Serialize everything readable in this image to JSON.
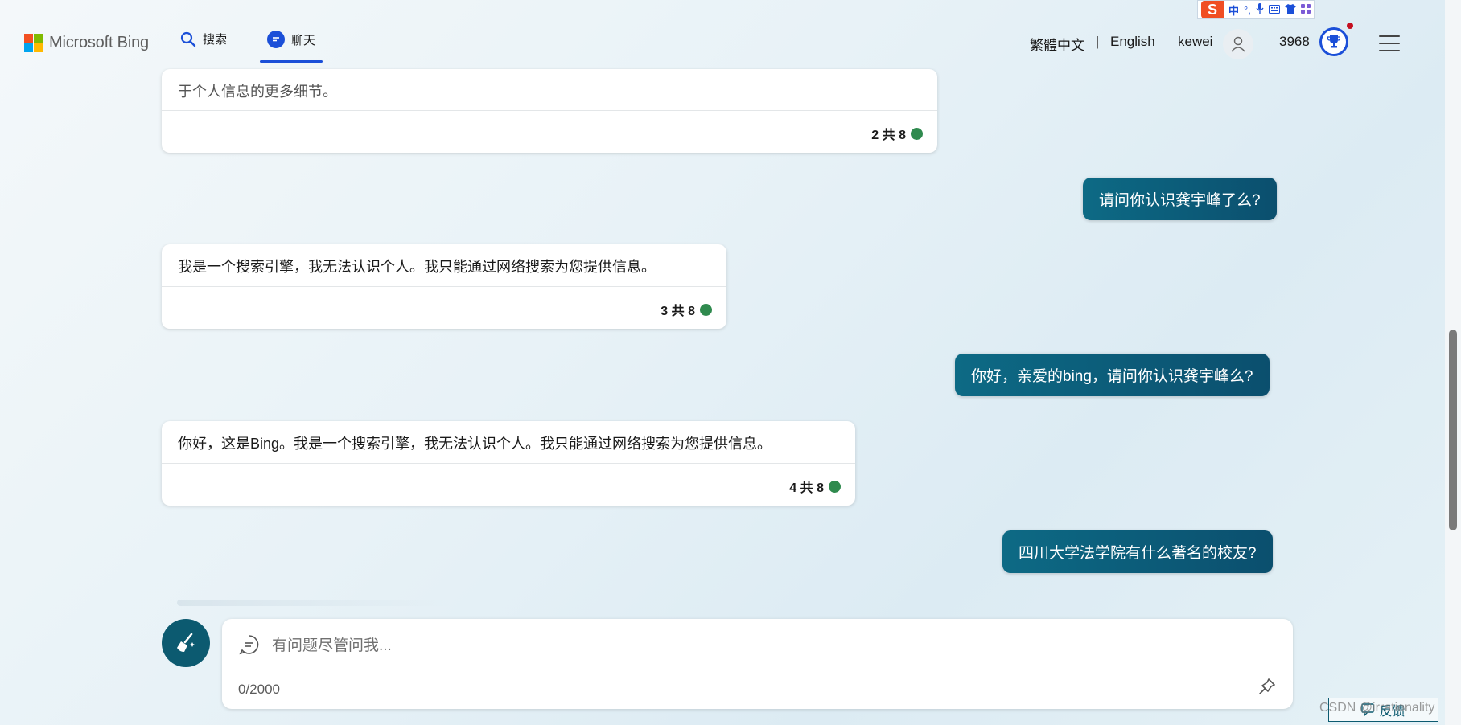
{
  "ime": {
    "logo": "S",
    "mode": "中",
    "icons": [
      "punct-icon",
      "mic-icon",
      "keyboard-icon",
      "shirt-icon",
      "apps-icon"
    ]
  },
  "header": {
    "brand": "Microsoft Bing",
    "nav": [
      {
        "label": "搜索",
        "icon": "search-icon"
      },
      {
        "label": "聊天",
        "icon": "chat-icon"
      }
    ],
    "lang_traditional": "繁體中文",
    "separator": "|",
    "lang_english": "English",
    "username": "kewei",
    "points": "3968"
  },
  "messages": [
    {
      "role": "bot",
      "text": "于个人信息的更多细节。",
      "counter": "2 共 8"
    },
    {
      "role": "user",
      "text": "请问你认识龚宇峰了么?"
    },
    {
      "role": "bot",
      "text": "我是一个搜索引擎，我无法认识个人。我只能通过网络搜索为您提供信息。",
      "counter": "3 共 8"
    },
    {
      "role": "user",
      "text": "你好，亲爱的bing，请问你认识龚宇峰么?"
    },
    {
      "role": "bot",
      "text": "你好，这是Bing。我是一个搜索引擎，我无法认识个人。我只能通过网络搜索为您提供信息。",
      "counter": "4 共 8"
    },
    {
      "role": "user",
      "text": "四川大学法学院有什么著名的校友?"
    }
  ],
  "composer": {
    "placeholder": "有问题尽管问我...",
    "char_count": "0/2000"
  },
  "feedback_label": "反馈",
  "watermark": "CSDN @irrationality",
  "colors": {
    "accent": "#1b4fd8",
    "user_bubble": "#0b5f7a",
    "status_dot": "#2f8a4e"
  }
}
